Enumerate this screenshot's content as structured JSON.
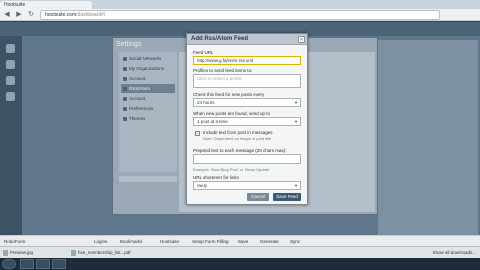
{
  "browser": {
    "tab_title": "Hootsuite",
    "url_host": "hootsuite.com",
    "url_path": "/dashboard#/",
    "back_label": "◀",
    "forward_label": "▶",
    "reload_label": "↻"
  },
  "settings": {
    "title": "Settings",
    "items": [
      {
        "label": "Social Networks"
      },
      {
        "label": "My Organizations"
      },
      {
        "label": "Account"
      },
      {
        "label": "RSS/Atom"
      },
      {
        "label": "Account"
      },
      {
        "label": "Preferences"
      },
      {
        "label": "Themes"
      }
    ]
  },
  "modal": {
    "title": "Add Rss/Atom Feed",
    "close_label": "×",
    "feed_url_label": "Feed URL",
    "feed_url_value": "http://www.g.fa/rss/s-rss.xml",
    "profiles_label": "Profiles to send feed items to:",
    "profiles_placeholder": "Click to select a profile",
    "check_label": "Check this feed for new posts every",
    "check_value": "24 hours",
    "when_label": "When new posts are found, send up to",
    "when_value": "1 post at a time",
    "include_label": "Include text from post in messages",
    "include_hint": "Note: Dependent on length of post title",
    "prepend_label": "Prepend text to each message (20 chars max):",
    "prepend_example": "Example: 'New Blog Post' or 'News Update'",
    "shortener_label": "URL shortener for links",
    "shortener_value": "ow.ly",
    "cancel_label": "Cancel",
    "save_label": "Save Feed"
  },
  "bookmarks": [
    {
      "label": "RoboForm"
    },
    {
      "label": "Logins"
    },
    {
      "label": "Bookmarks"
    },
    {
      "label": "Hootsuite"
    },
    {
      "label": "Setup Form Filling"
    },
    {
      "label": "Save"
    },
    {
      "label": "Generate"
    },
    {
      "label": "Sync"
    }
  ],
  "downloads": [
    {
      "label": "Preview.jpg"
    },
    {
      "label": "hse_membership_list...pdf"
    }
  ],
  "show_all": "Show all downloads..."
}
